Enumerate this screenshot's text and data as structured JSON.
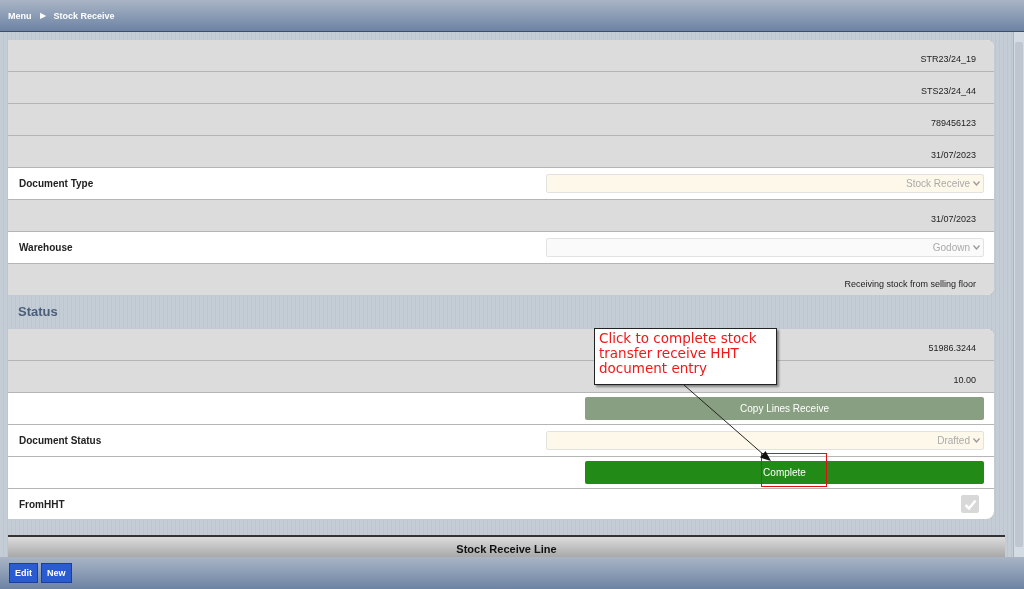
{
  "breadcrumb": {
    "root": "Menu",
    "separator": "▶",
    "current": "Stock Receive"
  },
  "header_card": {
    "rows": [
      {
        "kind": "readonly",
        "value": "STR23/24_19"
      },
      {
        "kind": "readonly",
        "value": "STS23/24_44"
      },
      {
        "kind": "readonly",
        "value": "789456123"
      },
      {
        "kind": "readonly",
        "value": "31/07/2023"
      },
      {
        "kind": "select",
        "label": "Document Type",
        "value": "Stock Receive",
        "mandatory": true
      },
      {
        "kind": "readonly",
        "value": "31/07/2023"
      },
      {
        "kind": "select",
        "label": "Warehouse",
        "value": "Godown",
        "mandatory": false
      },
      {
        "kind": "readonly",
        "value": "Receiving stock from selling floor"
      }
    ]
  },
  "status_section": {
    "title": "Status",
    "rows": [
      {
        "kind": "readonly",
        "value": "51986.3244"
      },
      {
        "kind": "readonly",
        "value": "10.00"
      },
      {
        "kind": "button",
        "label": "Copy Lines Receive",
        "disabled": true
      },
      {
        "kind": "select",
        "label": "Document Status",
        "value": "Drafted",
        "mandatory": true
      },
      {
        "kind": "button",
        "label": "Complete",
        "disabled": false
      },
      {
        "kind": "checkbox",
        "label": "FromHHT",
        "checked": true,
        "disabled": true
      }
    ]
  },
  "lines_tab": {
    "title": "Stock Receive Line"
  },
  "annotation": {
    "text": "Click to complete stock transfer receive HHT document entry"
  },
  "toolbar": {
    "buttons": [
      "Edit",
      "New"
    ]
  }
}
